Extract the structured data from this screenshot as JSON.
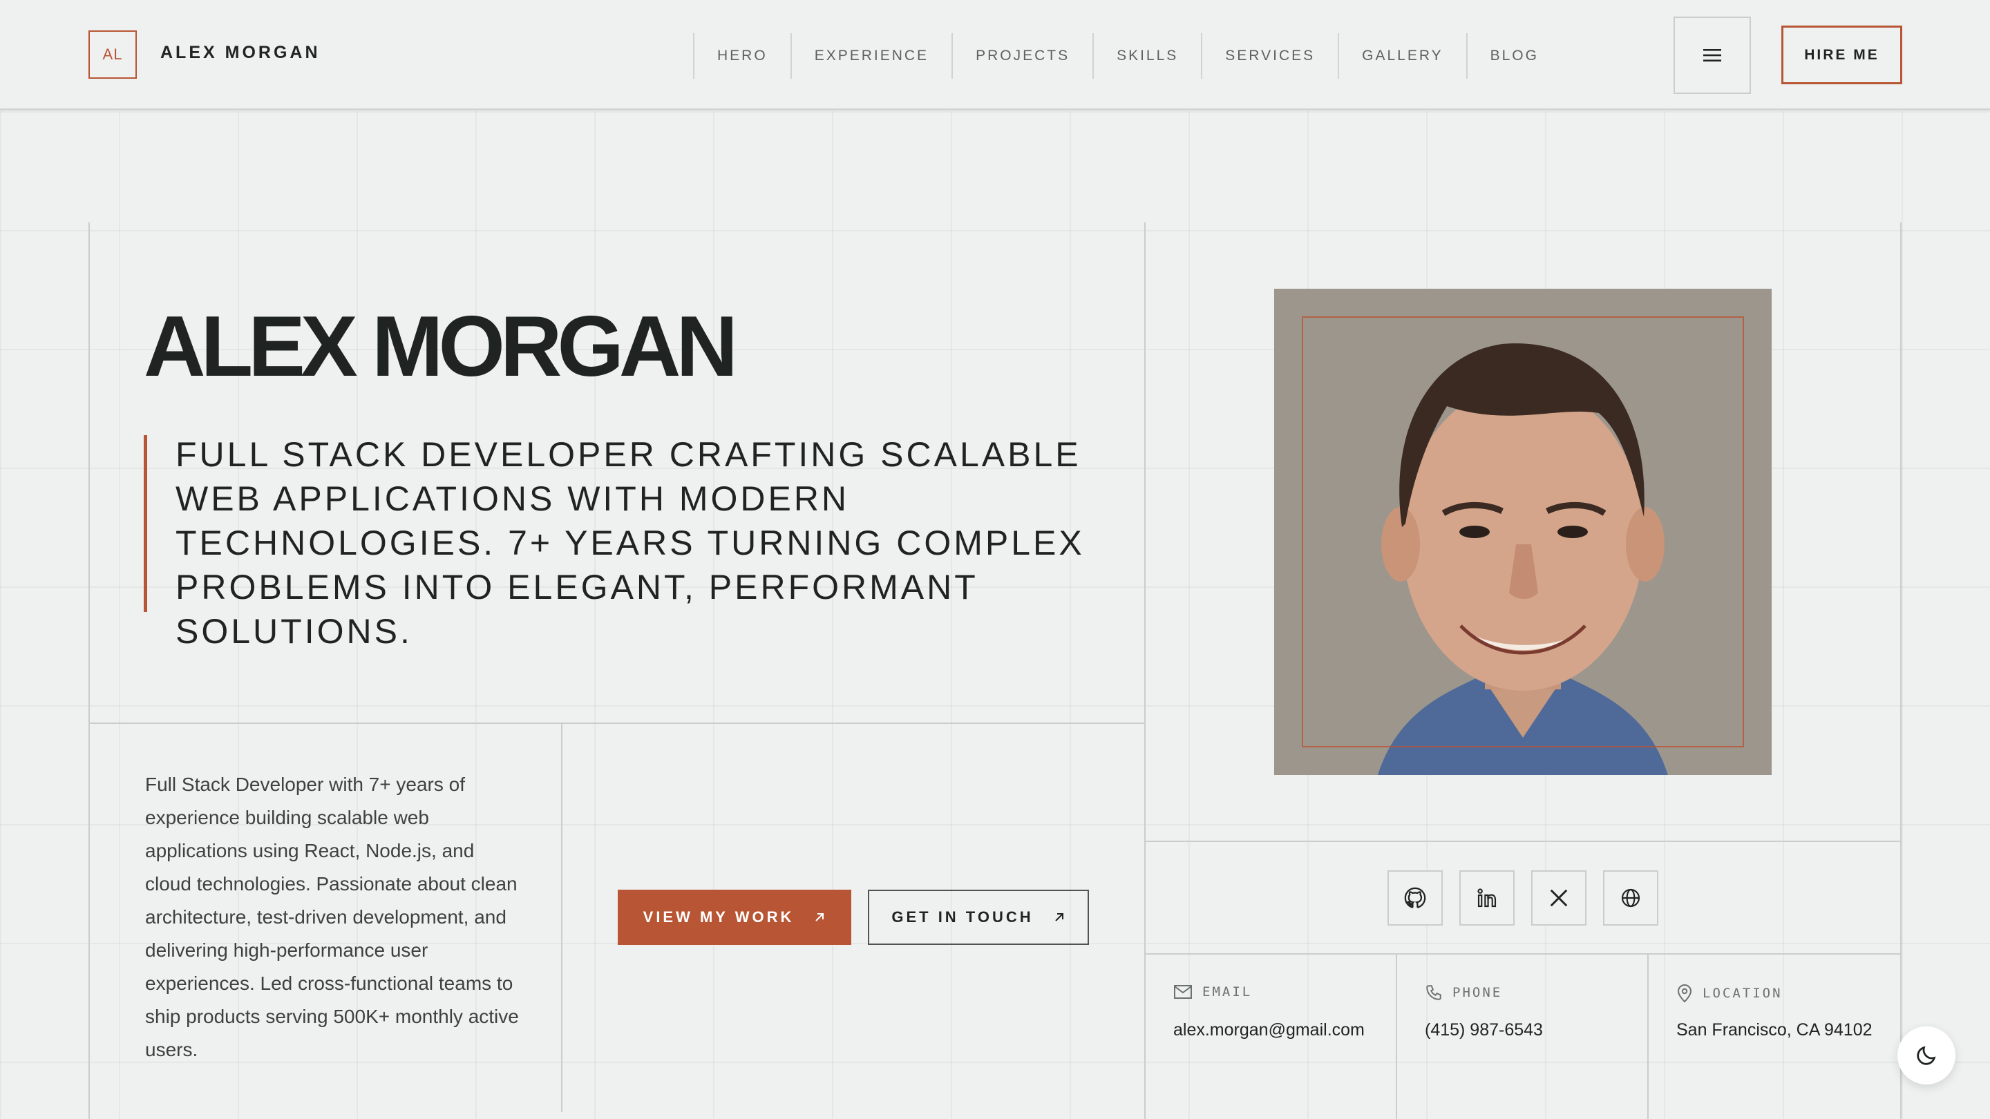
{
  "brand": {
    "initials": "AL",
    "name": "ALEX MORGAN"
  },
  "nav": {
    "items": [
      "HERO",
      "EXPERIENCE",
      "PROJECTS",
      "SKILLS",
      "SERVICES",
      "GALLERY",
      "BLOG"
    ]
  },
  "header": {
    "hire_label": "HIRE ME"
  },
  "hero": {
    "name": "ALEX MORGAN",
    "tagline": "FULL STACK DEVELOPER CRAFTING SCALABLE WEB APPLICATIONS WITH MODERN TECHNOLOGIES. 7+ YEARS TURNING COMPLEX PROBLEMS INTO ELEGANT, PERFORMANT SOLUTIONS.",
    "bio": "Full Stack Developer with 7+ years of experience building scalable web applications using React, Node.js, and cloud technologies. Passionate about clean architecture, test-driven development, and delivering high-performance user experiences. Led cross-functional teams to ship products serving 500K+ monthly active users.",
    "primary_cta": "VIEW MY WORK",
    "secondary_cta": "GET IN TOUCH"
  },
  "social": {
    "icons": [
      "github-icon",
      "linkedin-icon",
      "x-icon",
      "globe-icon"
    ]
  },
  "contact": {
    "email": {
      "label": "EMAIL",
      "value": "alex.morgan@gmail.com"
    },
    "phone": {
      "label": "PHONE",
      "value": "(415) 987-6543"
    },
    "location": {
      "label": "LOCATION",
      "value": "San Francisco, CA 94102"
    }
  },
  "colors": {
    "accent": "#b85535",
    "background": "#eef1ef",
    "text": "#1f2422"
  }
}
